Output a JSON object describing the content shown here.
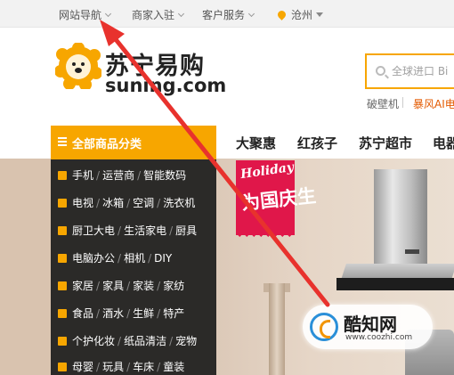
{
  "topbar": {
    "site_nav": "网站导航",
    "merchant": "商家入驻",
    "service": "客户服务",
    "city": "沧州"
  },
  "brand": {
    "cn_name": "苏宁易购",
    "en_name": "suning.com"
  },
  "search": {
    "placeholder": "全球进口 Bi",
    "hot_words": [
      "破壁机",
      "暴风AI电"
    ]
  },
  "nav": {
    "all_categories": "全部商品分类",
    "links": [
      "大聚惠",
      "红孩子",
      "苏宁超市",
      "电器"
    ]
  },
  "categories": [
    [
      "手机",
      "运营商",
      "智能数码"
    ],
    [
      "电视",
      "冰箱",
      "空调",
      "洗衣机"
    ],
    [
      "厨卫大电",
      "生活家电",
      "厨具"
    ],
    [
      "电脑办公",
      "相机",
      "DIY"
    ],
    [
      "家居",
      "家具",
      "家装",
      "家纺"
    ],
    [
      "食品",
      "酒水",
      "生鲜",
      "特产"
    ],
    [
      "个护化妆",
      "纸品清洁",
      "宠物"
    ],
    [
      "母婴",
      "玩具",
      "车床",
      "童装"
    ]
  ],
  "banner": {
    "badge_en": "Holiday",
    "badge_cn": "为国庆生"
  },
  "watermark": {
    "name": "酷知网",
    "url": "www.coozhi.com"
  },
  "colors": {
    "accent": "#f7a600",
    "category_bg": "#2b2a28",
    "arrow": "#e8322d",
    "badge": "#e0174a"
  }
}
